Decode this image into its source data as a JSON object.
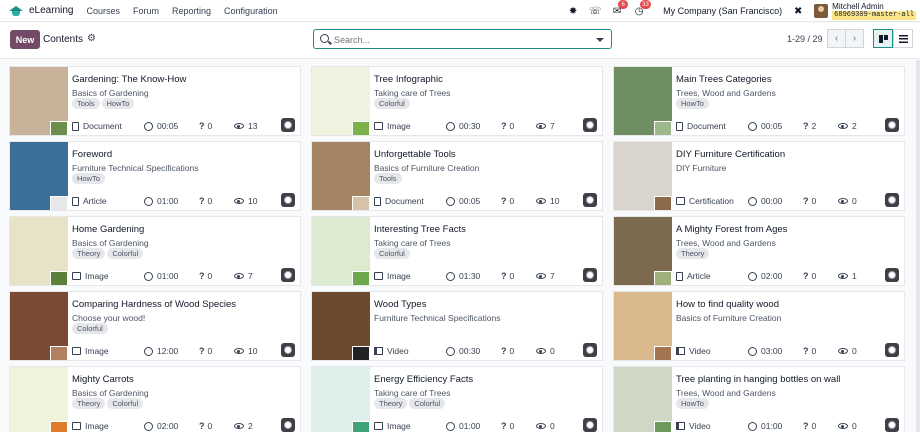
{
  "navbar": {
    "app_name": "eLearning",
    "menu": [
      "Courses",
      "Forum",
      "Reporting",
      "Configuration"
    ],
    "icons": [
      "bug-icon",
      "phone-icon",
      "chat-icon",
      "activity-icon"
    ],
    "chat_badge": "6",
    "activity_badge": "33",
    "company": "My Company (San Francisco)",
    "user_name": "Mitchell Admin",
    "db_name": "68969309-master-all"
  },
  "control": {
    "new_label": "New",
    "breadcrumb": "Contents",
    "search_placeholder": "Search...",
    "pager": "1-29 / 29"
  },
  "colors": {
    "brand": "#714b67",
    "accent": "#1c8c88"
  },
  "cards": [
    {
      "title": "Gardening: The Know-How",
      "course": "Basics of Gardening",
      "tags": [
        "Tools",
        "HowTo"
      ],
      "type": "Document",
      "type_icon": "doc",
      "duration": "00:05",
      "questions": "0",
      "views": "13",
      "thumb": "#c8b39a",
      "thumb2": "#6b8f4a"
    },
    {
      "title": "Tree Infographic",
      "course": "Taking care of Trees",
      "tags": [
        "Colorful"
      ],
      "type": "Image",
      "type_icon": "img",
      "duration": "00:30",
      "questions": "0",
      "views": "7",
      "thumb": "#eef4e0",
      "thumb2": "#7bb34a"
    },
    {
      "title": "Main Trees Categories",
      "course": "Trees, Wood and Gardens",
      "tags": [
        "HowTo"
      ],
      "type": "Document",
      "type_icon": "doc",
      "duration": "00:05",
      "questions": "2",
      "views": "2",
      "thumb": "#6f8f63",
      "thumb2": "#9db88a"
    },
    {
      "title": "Foreword",
      "course": "Furniture Technical Specifications",
      "tags": [
        "HowTo"
      ],
      "type": "Article",
      "type_icon": "doc",
      "duration": "01:00",
      "questions": "0",
      "views": "10",
      "thumb": "#3b6f97",
      "thumb2": "#e5e7eb"
    },
    {
      "title": "Unforgettable Tools",
      "course": "Basics of Furniture Creation",
      "tags": [
        "Tools"
      ],
      "type": "Document",
      "type_icon": "doc",
      "duration": "00:05",
      "questions": "0",
      "views": "10",
      "thumb": "#a58463",
      "thumb2": "#d6c2a8"
    },
    {
      "title": "DIY Furniture Certification",
      "course": "DIY Furniture",
      "tags": [],
      "type": "Certification",
      "type_icon": "cert",
      "duration": "00:00",
      "questions": "0",
      "views": "0",
      "thumb": "#d9d4cc",
      "thumb2": "#8a6a4a"
    },
    {
      "title": "Home Gardening",
      "course": "Basics of Gardening",
      "tags": [
        "Theory",
        "Colorful"
      ],
      "type": "Image",
      "type_icon": "img",
      "duration": "01:00",
      "questions": "0",
      "views": "7",
      "thumb": "#e8e2c6",
      "thumb2": "#5c7f3a"
    },
    {
      "title": "Interesting Tree Facts",
      "course": "Taking care of Trees",
      "tags": [
        "Colorful"
      ],
      "type": "Image",
      "type_icon": "img",
      "duration": "01:30",
      "questions": "0",
      "views": "7",
      "thumb": "#dcebcf",
      "thumb2": "#6ea84a"
    },
    {
      "title": "A Mighty Forest from Ages",
      "course": "Trees, Wood and Gardens",
      "tags": [
        "Theory"
      ],
      "type": "Article",
      "type_icon": "doc",
      "duration": "02:00",
      "questions": "0",
      "views": "1",
      "thumb": "#7c6a4e",
      "thumb2": "#9fb07a"
    },
    {
      "title": "Comparing Hardness of Wood Species",
      "course": "Choose your wood!",
      "tags": [
        "Colorful"
      ],
      "type": "Image",
      "type_icon": "img",
      "duration": "12:00",
      "questions": "0",
      "views": "10",
      "thumb": "#7a4a34",
      "thumb2": "#b08060"
    },
    {
      "title": "Wood Types",
      "course": "Furniture Technical Specifications",
      "tags": [],
      "type": "Video",
      "type_icon": "vid",
      "duration": "00:30",
      "questions": "0",
      "views": "0",
      "thumb": "#6b4a2e",
      "thumb2": "#222222"
    },
    {
      "title": "How to find quality wood",
      "course": "Basics of Furniture Creation",
      "tags": [],
      "type": "Video",
      "type_icon": "vid",
      "duration": "03:00",
      "questions": "0",
      "views": "0",
      "thumb": "#d8b88c",
      "thumb2": "#a0754f"
    },
    {
      "title": "Mighty Carrots",
      "course": "Basics of Gardening",
      "tags": [
        "Theory",
        "Colorful"
      ],
      "type": "Image",
      "type_icon": "img",
      "duration": "02:00",
      "questions": "0",
      "views": "2",
      "thumb": "#eef3dc",
      "thumb2": "#e07a2a"
    },
    {
      "title": "Energy Efficiency Facts",
      "course": "Taking care of Trees",
      "tags": [
        "Theory",
        "Colorful"
      ],
      "type": "Image",
      "type_icon": "img",
      "duration": "01:00",
      "questions": "0",
      "views": "0",
      "thumb": "#dff0ea",
      "thumb2": "#3fa37a"
    },
    {
      "title": "Tree planting in hanging bottles on wall",
      "course": "Trees, Wood and Gardens",
      "tags": [
        "HowTo"
      ],
      "type": "Video",
      "type_icon": "vid",
      "duration": "01:00",
      "questions": "0",
      "views": "0",
      "thumb": "#cfd8c4",
      "thumb2": "#6c9a5a"
    }
  ]
}
